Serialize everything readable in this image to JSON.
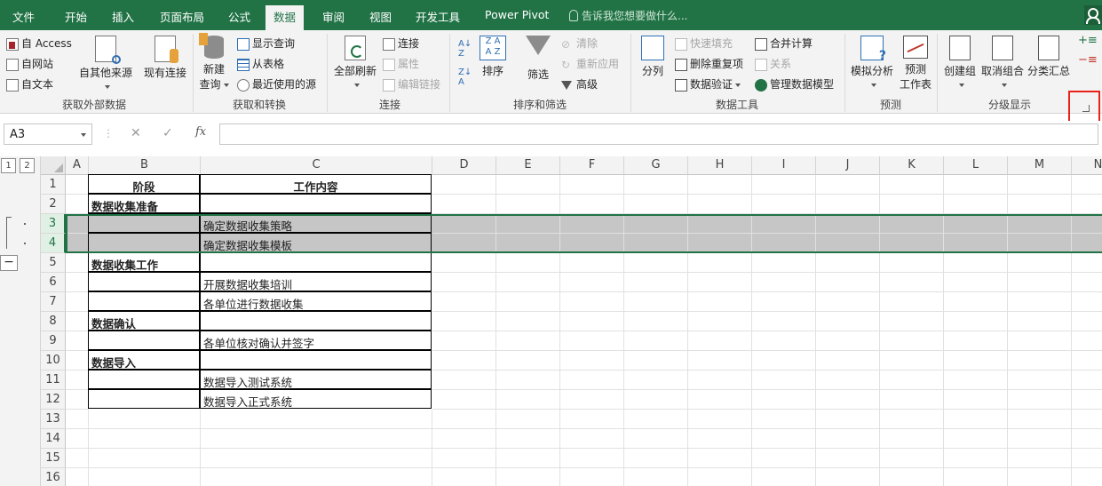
{
  "tabs": [
    "文件",
    "开始",
    "插入",
    "页面布局",
    "公式",
    "数据",
    "审阅",
    "视图",
    "开发工具",
    "Power Pivot"
  ],
  "active_tab": "数据",
  "tell_me": "告诉我您想要做什么...",
  "ribbon": {
    "get_external": {
      "access": "自 Access",
      "web": "自网站",
      "text": "自文本",
      "other": "自其他来源",
      "existing": "现有连接",
      "group": "获取外部数据"
    },
    "get_transform": {
      "new_query": "新建",
      "new_query2": "查询",
      "show_queries": "显示查询",
      "from_table": "从表格",
      "recent": "最近使用的源",
      "group": "获取和转换"
    },
    "connections": {
      "refresh_all": "全部刷新",
      "connections": "连接",
      "properties": "属性",
      "edit_links": "编辑链接",
      "group": "连接"
    },
    "sort_filter": {
      "sort": "排序",
      "filter": "筛选",
      "clear": "清除",
      "reapply": "重新应用",
      "advanced": "高级",
      "group": "排序和筛选"
    },
    "data_tools": {
      "split": "分列",
      "flash_fill": "快速填充",
      "remove_dup": "删除重复项",
      "validation": "数据验证",
      "consolidate": "合并计算",
      "relationships": "关系",
      "manage_model": "管理数据模型",
      "group": "数据工具"
    },
    "forecast": {
      "what_if": "模拟分析",
      "forecast_sheet": "预测",
      "forecast_sheet2": "工作表",
      "group": "预测"
    },
    "outline": {
      "group_btn": "创建组",
      "ungroup": "取消组合",
      "subtotal": "分类汇总",
      "group": "分级显示"
    }
  },
  "formula_bar": {
    "name_box": "A3",
    "cancel": "✕",
    "enter": "✓",
    "fx": "fx",
    "value": ""
  },
  "outline_levels": [
    "1",
    "2"
  ],
  "outline_minus": "−",
  "columns": [
    "A",
    "B",
    "C",
    "D",
    "E",
    "F",
    "G",
    "H",
    "I",
    "J",
    "K",
    "L",
    "M",
    "N"
  ],
  "rows": [
    "1",
    "2",
    "3",
    "4",
    "5",
    "6",
    "7",
    "8",
    "9",
    "10",
    "11",
    "12",
    "13",
    "14",
    "15",
    "16"
  ],
  "cells": {
    "B1": "阶段",
    "C1": "工作内容",
    "B2": "数据收集准备",
    "C3": "确定数据收集策略",
    "C4": "确定数据收集模板",
    "B5": "数据收集工作",
    "C6": "开展数据收集培训",
    "C7": "各单位进行数据收集",
    "B8": "数据确认",
    "C9": "各单位核对确认并签字",
    "B10": "数据导入",
    "C11": "数据导入测试系统",
    "C12": "数据导入正式系统"
  },
  "colors": {
    "brand": "#217346",
    "highlight": "#e8221a",
    "selected_row": "#c6c6c6"
  }
}
